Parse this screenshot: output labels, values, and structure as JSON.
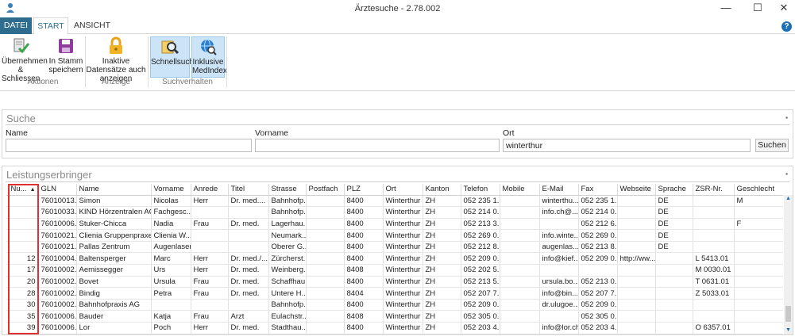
{
  "window": {
    "title": "Ärztesuche - 2.78.002",
    "minimize": "—",
    "maximize": "☐",
    "close": "✕"
  },
  "ribbon_tabs": {
    "datei": "DATEI",
    "start": "START",
    "ansicht": "ANSICHT"
  },
  "help": "?",
  "ribbon": {
    "uebernehmen": "Übernehmen & Schliessen",
    "stamm": "In Stamm speichern",
    "inaktive": "Inaktive Datensätze auch anzeigen",
    "schnellsuche": "Schnellsuche",
    "medindex": "Inklusive MedIndex",
    "group_aktionen": "Aktionen",
    "group_anzeige": "Anzeige",
    "group_suchverhalten": "Suchverhalten"
  },
  "search": {
    "title": "Suche",
    "name_label": "Name",
    "vorname_label": "Vorname",
    "ort_label": "Ort",
    "name_value": "",
    "vorname_value": "",
    "ort_value": "winterthur",
    "button": "Suchen"
  },
  "results": {
    "title": "Leistungserbringer",
    "columns": [
      "Nu...",
      "GLN",
      "Name",
      "Vorname",
      "Anrede",
      "Titel",
      "Strasse",
      "Postfach",
      "PLZ",
      "Ort",
      "Kanton",
      "Telefon",
      "Mobile",
      "E-Mail",
      "Fax",
      "Webseite",
      "Sprache",
      "ZSR-Nr.",
      "Geschlecht"
    ],
    "rows": [
      [
        "",
        "76010013...",
        "Simon",
        "Nicolas",
        "Herr",
        "Dr. med....",
        "Bahnhofp...",
        "",
        "8400",
        "Winterthur",
        "ZH",
        "052 235 1...",
        "",
        "winterthu...",
        "052 235 1...",
        "",
        "DE",
        "",
        "M"
      ],
      [
        "",
        "76010033...",
        "KIND Hörzentralen AG",
        "Fachgesc...",
        "",
        "",
        "Bahnhofp...",
        "",
        "8400",
        "Winterthur",
        "ZH",
        "052 214 0...",
        "",
        "info.ch@...",
        "052 214 0...",
        "",
        "DE",
        "",
        ""
      ],
      [
        "",
        "76010006...",
        "Stuker-Chicca",
        "Nadia",
        "Frau",
        "Dr. med.",
        "Lagerhau...",
        "",
        "8400",
        "Winterthur",
        "ZH",
        "052 213 3...",
        "",
        "",
        "052 212 6...",
        "",
        "DE",
        "",
        "F"
      ],
      [
        "",
        "76010021...",
        "Clienia Gruppenpraxe...",
        "Clienia W...",
        "",
        "",
        "Neumark...",
        "",
        "8400",
        "Winterthur",
        "ZH",
        "052 269 0...",
        "",
        "info.winte...",
        "052 269 0...",
        "",
        "DE",
        "",
        ""
      ],
      [
        "",
        "76010021...",
        "Pallas Zentrum",
        "Augenlaser",
        "",
        "",
        "Oberer G...",
        "",
        "8400",
        "Winterthur",
        "ZH",
        "052 212 8...",
        "",
        "augenlas...",
        "052 213 8...",
        "",
        "DE",
        "",
        ""
      ],
      [
        "12",
        "76010004...",
        "Baltensperger",
        "Marc",
        "Herr",
        "Dr. med./...",
        "Zürcherst...",
        "",
        "8400",
        "Winterthur",
        "ZH",
        "052 209 0...",
        "",
        "info@kief...",
        "052 209 0...",
        "http://ww...",
        "",
        "L 5413.01",
        ""
      ],
      [
        "17",
        "76010002...",
        "Aemissegger",
        "Urs",
        "Herr",
        "Dr. med.",
        "Weinberg...",
        "",
        "8408",
        "Winterthur",
        "ZH",
        "052 202 5...",
        "",
        "",
        "",
        "",
        "",
        "M 0030.01",
        ""
      ],
      [
        "20",
        "76010002...",
        "Bovet",
        "Ursula",
        "Frau",
        "Dr. med.",
        "Schaffhau...",
        "",
        "8400",
        "Winterthur",
        "ZH",
        "052 213 5...",
        "",
        "ursula.bo...",
        "052 213 0...",
        "",
        "",
        "T 0631.01",
        ""
      ],
      [
        "28",
        "76010002...",
        "Bindig",
        "Petra",
        "Frau",
        "Dr. med.",
        "Untere H...",
        "",
        "8404",
        "Winterthur",
        "ZH",
        "052 207 7...",
        "",
        "info@bin...",
        "052 207 7...",
        "",
        "",
        "Z 5033.01",
        ""
      ],
      [
        "30",
        "76010002...",
        "Bahnhofpraxis AG",
        "",
        "",
        "",
        "Bahnhofp...",
        "",
        "8400",
        "Winterthur",
        "ZH",
        "052 209 0...",
        "",
        "dr.ulugoe...",
        "052 209 0...",
        "",
        "",
        "",
        ""
      ],
      [
        "35",
        "76010006...",
        "Bauder",
        "Katja",
        "Frau",
        "Arzt",
        "Eulachstr...",
        "",
        "8408",
        "Winterthur",
        "ZH",
        "052 305 0...",
        "",
        "",
        "052 305 0...",
        "",
        "",
        "",
        ""
      ],
      [
        "39",
        "76010006...",
        "Lor",
        "Poch",
        "Herr",
        "Dr. med.",
        "Stadthau...",
        "",
        "8400",
        "Winterthur",
        "ZH",
        "052 203 4...",
        "",
        "info@lor.ch",
        "052 203 4...",
        "",
        "",
        "O 6357.01",
        ""
      ]
    ]
  }
}
